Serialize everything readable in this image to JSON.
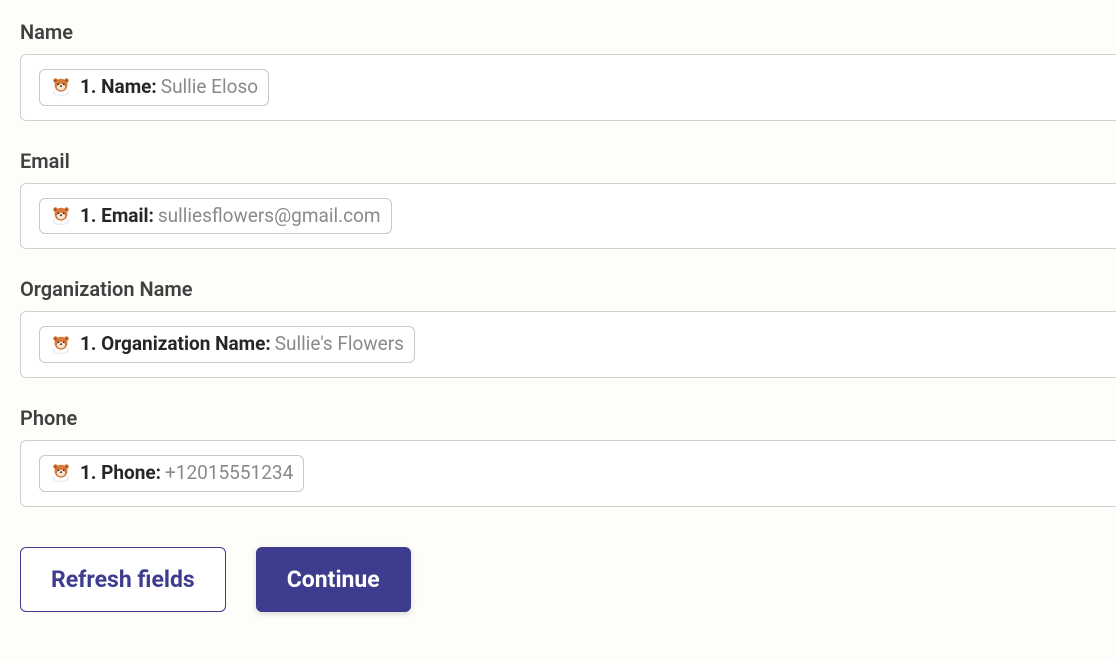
{
  "fields": [
    {
      "label": "Name",
      "token_label": "1. Name:",
      "token_value": "Sullie Eloso"
    },
    {
      "label": "Email",
      "token_label": "1. Email:",
      "token_value": "sulliesflowers@gmail.com"
    },
    {
      "label": "Organization Name",
      "token_label": "1. Organization Name:",
      "token_value": "Sullie's Flowers"
    },
    {
      "label": "Phone",
      "token_label": "1. Phone:",
      "token_value": "+12015551234"
    }
  ],
  "buttons": {
    "refresh": "Refresh fields",
    "continue": "Continue"
  }
}
